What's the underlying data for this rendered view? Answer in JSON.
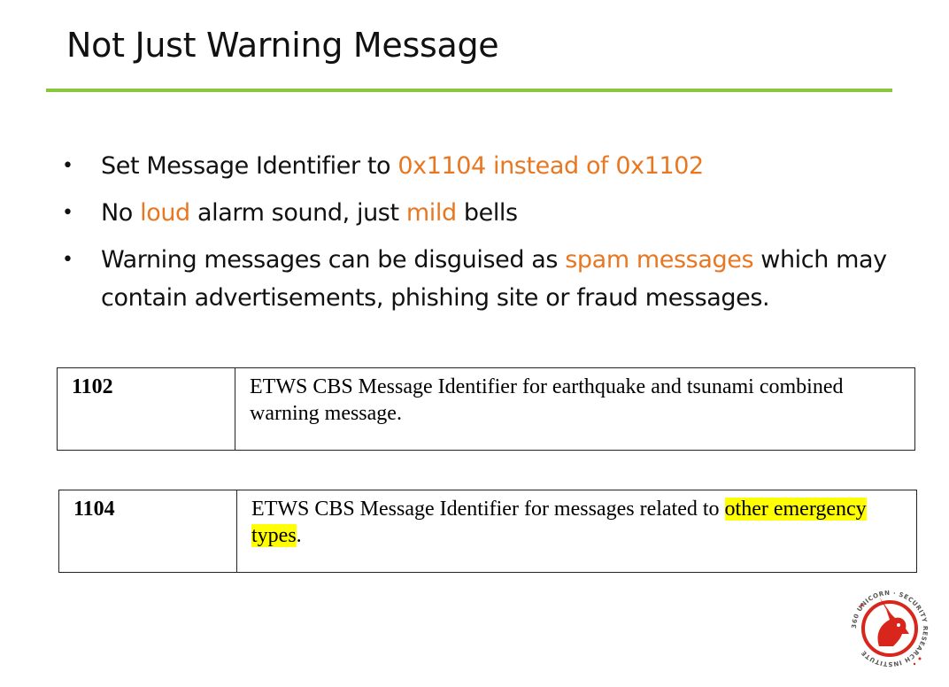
{
  "slide": {
    "title": "Not Just Warning Message"
  },
  "bullets": [
    {
      "parts": [
        "Set Message Identifier to ",
        "0x1104 instead of 0x1102"
      ]
    },
    {
      "parts": [
        "No ",
        "loud",
        " alarm sound, just ",
        "mild",
        " bells"
      ]
    },
    {
      "parts": [
        "Warning messages can be disguised as ",
        "spam messages",
        " which may contain advertisements, phishing site or fraud messages."
      ]
    }
  ],
  "tables": [
    {
      "id": "1102",
      "description": "ETWS CBS Message Identifier for earthquake and tsunami combined warning message."
    },
    {
      "id": "1104",
      "description_plain": "ETWS CBS Message Identifier for messages related to ",
      "description_highlight": "other emergency types",
      "description_end": "."
    }
  ],
  "logo": {
    "text": "360 UNICORN · SECURITY RESEARCH INSTITUTE",
    "icon": "unicorn-head-icon"
  },
  "colors": {
    "accent": "#e87722",
    "rule": "#8cc63f",
    "highlight": "#ffff00",
    "logo_red": "#d9261c"
  }
}
